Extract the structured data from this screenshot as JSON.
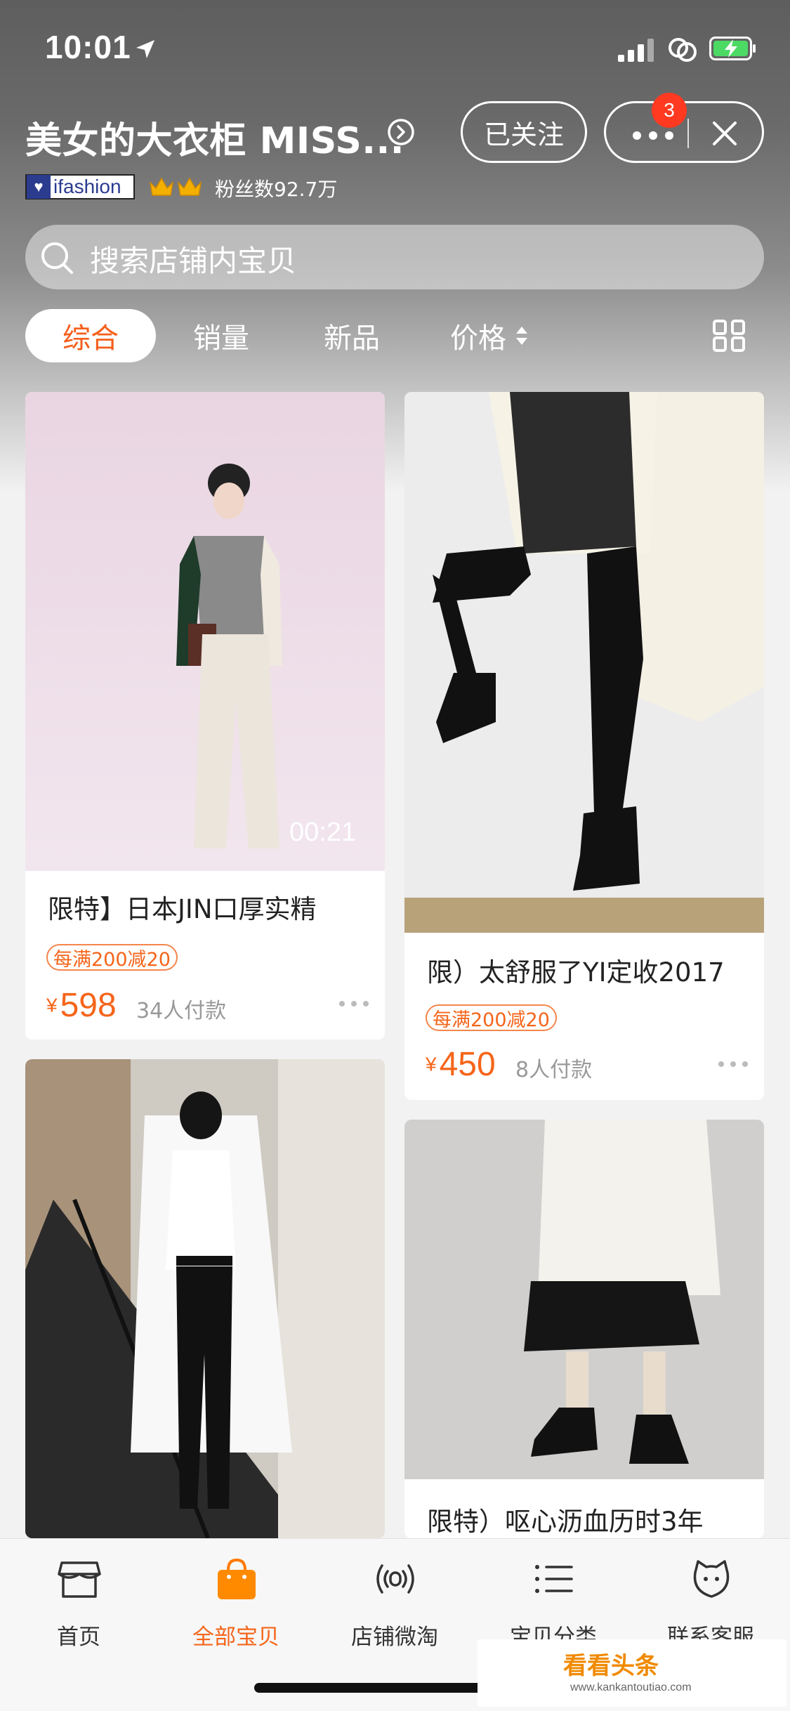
{
  "status_bar": {
    "time": "10:01"
  },
  "store": {
    "name": "美女的大衣柜 MISS...",
    "follow_label": "已关注",
    "message_badge": "3",
    "brand_tag": "ifashion",
    "fans": "粉丝数92.7万"
  },
  "search": {
    "placeholder": "搜索店铺内宝贝"
  },
  "tabs": [
    {
      "label": "综合",
      "active": true
    },
    {
      "label": "销量"
    },
    {
      "label": "新品"
    },
    {
      "label": "价格"
    }
  ],
  "products": [
    {
      "title": "限特】日本JIN口厚实精",
      "promo": "每满200减20",
      "yen": "¥",
      "price": "598",
      "paid": "34人付款",
      "video_duration": "00:21"
    },
    {
      "title": "限）太舒服了YI定收2017",
      "promo": "每满200减20",
      "yen": "¥",
      "price": "450",
      "paid": "8人付款"
    },
    {
      "title": ""
    },
    {
      "title": "限特）呕心沥血历时3年"
    }
  ],
  "tabbar": [
    {
      "label": "首页",
      "icon": "shop-icon"
    },
    {
      "label": "全部宝贝",
      "icon": "shopping-bag-icon",
      "active": true
    },
    {
      "label": "店铺微淘",
      "icon": "broadcast-icon"
    },
    {
      "label": "宝贝分类",
      "icon": "list-icon"
    },
    {
      "label": "联系客服",
      "icon": "service-face-icon"
    }
  ],
  "watermark": {
    "title": "看看头条",
    "url": "www.kankantoutiao.com"
  },
  "colors": {
    "accent": "#f5651a",
    "badge": "#ff3a20",
    "battery": "#4cd964"
  }
}
